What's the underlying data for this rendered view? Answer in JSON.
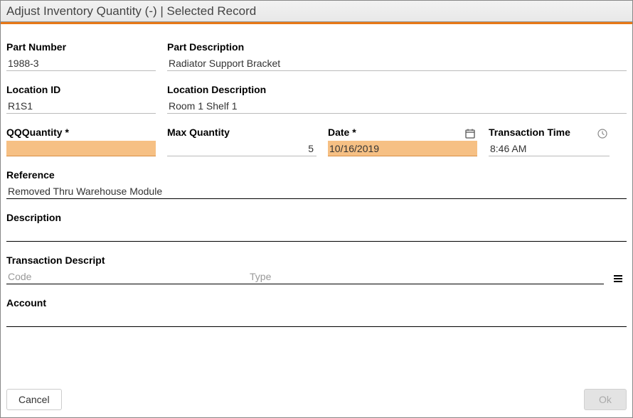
{
  "window": {
    "title": "Adjust Inventory Quantity (-) | Selected Record"
  },
  "labels": {
    "part_number": "Part Number",
    "part_description": "Part Description",
    "location_id": "Location ID",
    "location_description": "Location Description",
    "qq_quantity": "QQQuantity *",
    "max_quantity": "Max Quantity",
    "date": "Date *",
    "transaction_time": "Transaction Time",
    "reference": "Reference",
    "description": "Description",
    "transaction_descript": "Transaction Descript",
    "account": "Account"
  },
  "values": {
    "part_number": "1988-3",
    "part_description": "Radiator Support Bracket",
    "location_id": "R1S1",
    "location_description": "Room 1 Shelf 1",
    "qq_quantity": "",
    "max_quantity": "5",
    "date": "10/16/2019",
    "transaction_time": "8:46 AM",
    "reference": "Removed Thru Warehouse Module",
    "description": "",
    "td_code": "",
    "td_type": "",
    "account": ""
  },
  "placeholders": {
    "td_code": "Code",
    "td_type": "Type"
  },
  "buttons": {
    "cancel": "Cancel",
    "ok": "Ok"
  }
}
